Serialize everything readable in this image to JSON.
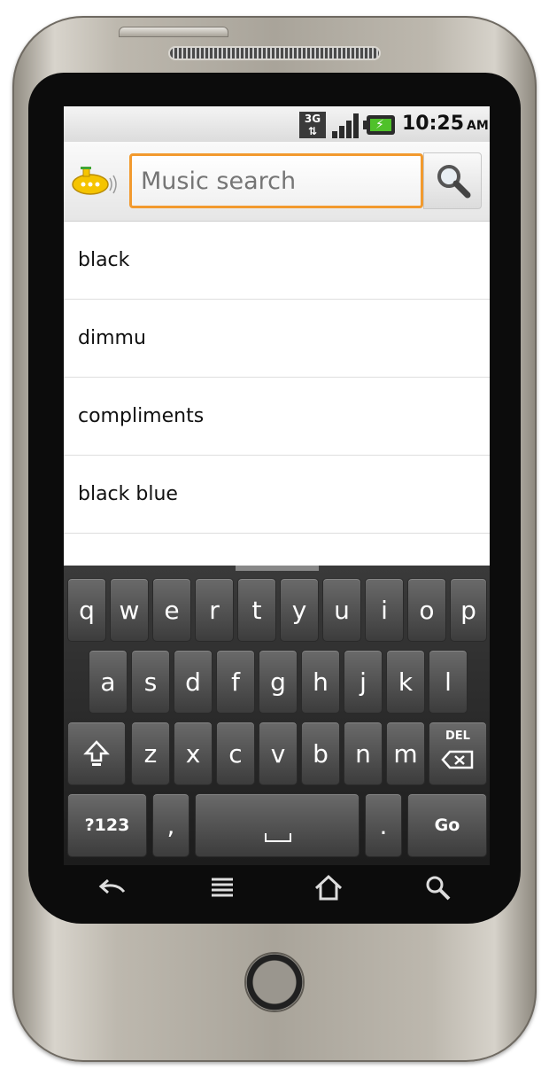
{
  "statusbar": {
    "network": "3G",
    "time": "10:25",
    "ampm": "AM"
  },
  "search": {
    "placeholder": "Music search"
  },
  "suggestions": [
    "black",
    "dimmu",
    "compliments",
    "black blue"
  ],
  "keyboard": {
    "row1": [
      "q",
      "w",
      "e",
      "r",
      "t",
      "y",
      "u",
      "i",
      "o",
      "p"
    ],
    "row2": [
      "a",
      "s",
      "d",
      "f",
      "g",
      "h",
      "j",
      "k",
      "l"
    ],
    "row3": [
      "z",
      "x",
      "c",
      "v",
      "b",
      "n",
      "m"
    ],
    "del_label": "DEL",
    "symbols_label": "?123",
    "comma": ",",
    "period": ".",
    "go_label": "Go"
  },
  "colors": {
    "search_border": "#f29a2e",
    "battery": "#4fc12a"
  },
  "icons": [
    "submarine-app-icon",
    "search-icon",
    "shift-icon",
    "backspace-icon",
    "back-icon",
    "menu-icon",
    "home-icon",
    "search-nav-icon"
  ]
}
